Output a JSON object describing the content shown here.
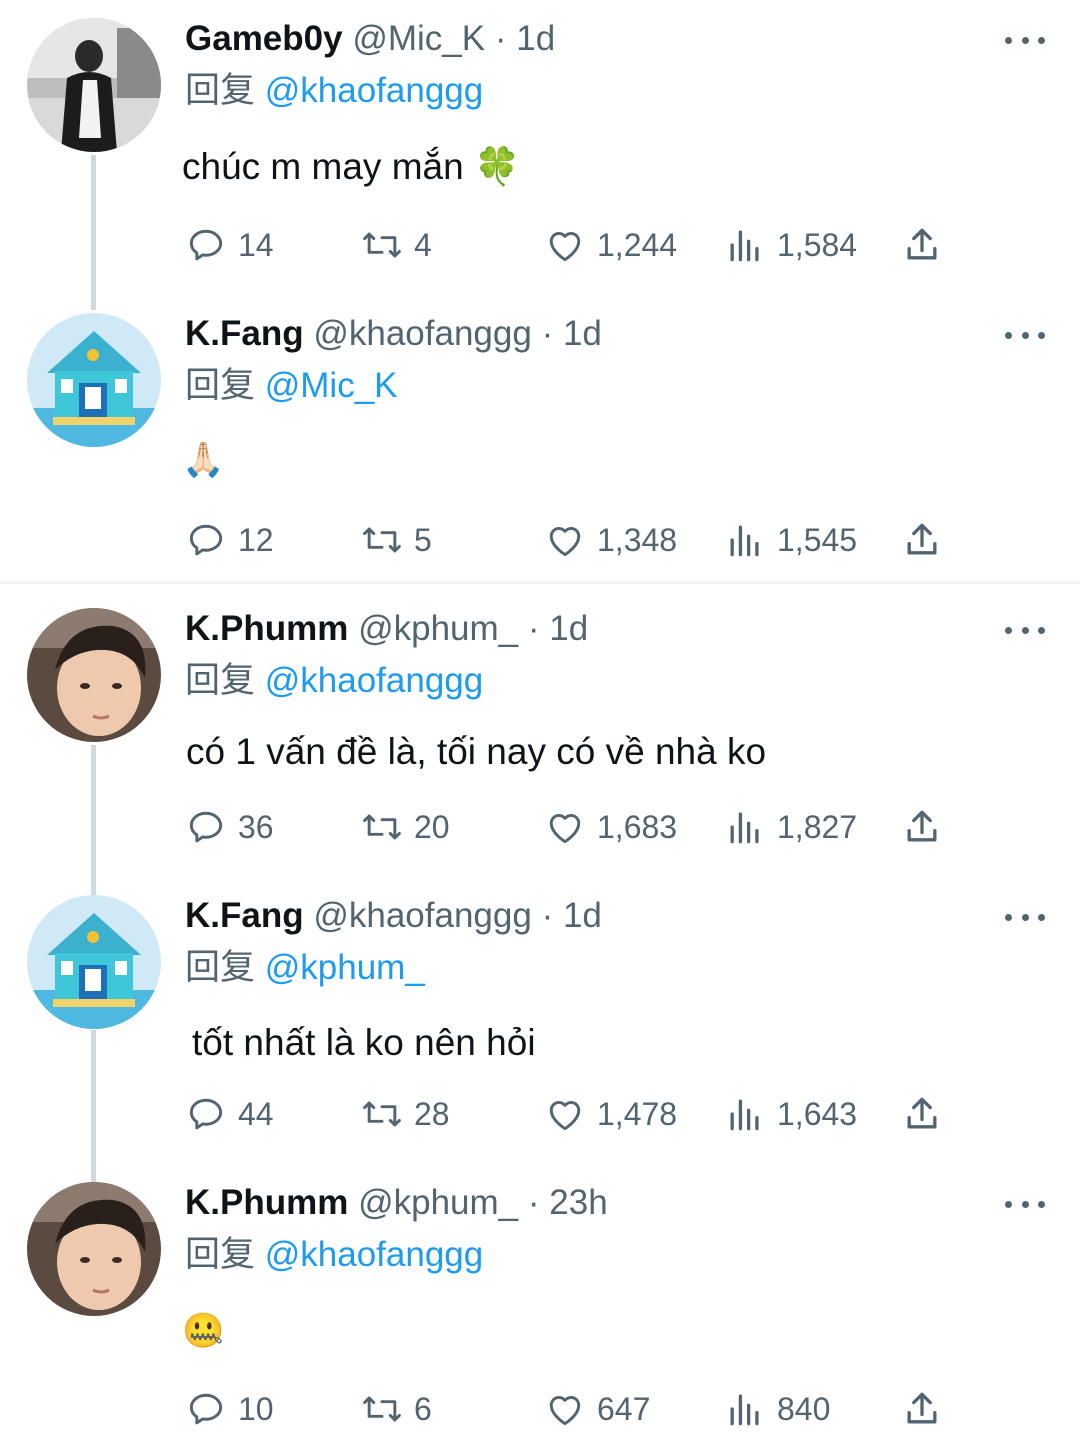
{
  "reply_prefix": "回复",
  "tweets": [
    {
      "name": "Gameb0y",
      "handle": "@Mic_K",
      "separator": "·",
      "time": "1d",
      "reply_to": "@khaofanggg",
      "text": "chúc m may mắn 🍀",
      "replies": "14",
      "retweets": "4",
      "likes": "1,244",
      "views": "1,584"
    },
    {
      "name": "K.Fang",
      "handle": "@khaofanggg",
      "separator": "·",
      "time": "1d",
      "reply_to": "@Mic_K",
      "text": "🙏🏻",
      "replies": "12",
      "retweets": "5",
      "likes": "1,348",
      "views": "1,545"
    },
    {
      "name": "K.Phumm",
      "handle": "@kphum_",
      "separator": "·",
      "time": "1d",
      "reply_to": "@khaofanggg",
      "text": "có 1 vấn đề là, tối nay có về nhà ko",
      "replies": "36",
      "retweets": "20",
      "likes": "1,683",
      "views": "1,827"
    },
    {
      "name": "K.Fang",
      "handle": "@khaofanggg",
      "separator": "·",
      "time": "1d",
      "reply_to": "@kphum_",
      "text": "tốt nhất là ko nên hỏi",
      "replies": "44",
      "retweets": "28",
      "likes": "1,478",
      "views": "1,643"
    },
    {
      "name": "K.Phumm",
      "handle": "@kphum_",
      "separator": "·",
      "time": "23h",
      "reply_to": "@khaofanggg",
      "text": "🤐",
      "replies": "10",
      "retweets": "6",
      "likes": "647",
      "views": "840"
    }
  ],
  "colors": {
    "accent": "#1d9bf0",
    "secondary_text": "#536471",
    "primary_text": "#0f1419",
    "thread_line": "#cfd9de"
  }
}
